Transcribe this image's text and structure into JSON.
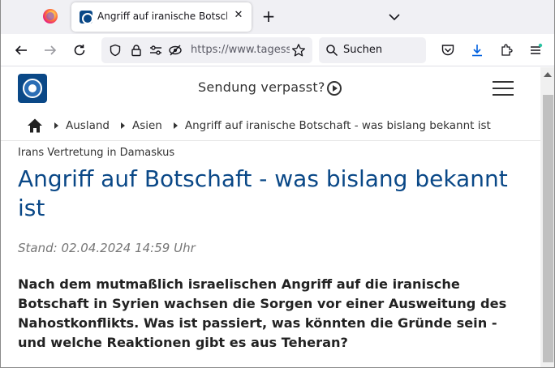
{
  "browser": {
    "tab": {
      "title": "Angriff auf iranische Botschaft",
      "close_glyph": "✕"
    },
    "new_tab_glyph": "+",
    "url": "https://www.tagesschau.de",
    "search_placeholder": "Suchen"
  },
  "site": {
    "header": {
      "sendung_label": "Sendung verpasst?"
    },
    "breadcrumbs": [
      {
        "label": "Ausland"
      },
      {
        "label": "Asien"
      },
      {
        "label": "Angriff auf iranische Botschaft - was bislang bekannt ist"
      }
    ]
  },
  "article": {
    "kicker": "Irans Vertretung in Damaskus",
    "headline": "Angriff auf Botschaft - was bislang bekannt ist",
    "stand": "Stand: 02.04.2024 14:59 Uhr",
    "teaser": "Nach dem mutmaßlich israelischen Angriff auf die iranische Botschaft in Syrien wachsen die Sorgen vor einer Ausweitung des Nahostkonflikts. Was ist passiert, was könnten die Gründe sein - und welche Reaktionen gibt es aus Teheran?"
  },
  "colors": {
    "brand_blue": "#0a4887",
    "headline": "#0a4887",
    "tabstrip_bg": "#f0f0f4"
  },
  "icons": [
    "firefox-icon",
    "tagesschau-favicon",
    "close-icon",
    "plus-icon",
    "chevron-down-icon",
    "back-icon",
    "forward-icon",
    "reload-icon",
    "shield-icon",
    "lock-icon",
    "permissions-icon",
    "tracking-off-icon",
    "star-icon",
    "search-icon",
    "pocket-icon",
    "download-icon",
    "extensions-icon",
    "menu-icon",
    "tagesschau-logo",
    "play-icon",
    "hamburger-icon",
    "home-icon"
  ]
}
